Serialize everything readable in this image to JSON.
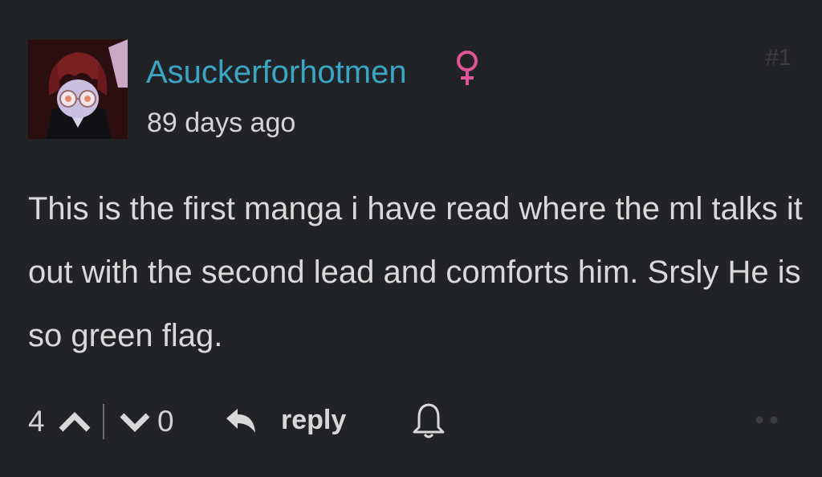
{
  "comment": {
    "username": "Asuckerforhotmen",
    "gender_icon": "female-symbol-icon",
    "timestamp": "89 days ago",
    "post_number": "#1",
    "body": "This is the first manga i have read where the ml talks it out with the second lead and comforts him. Srsly He is so green flag.",
    "upvotes": "4",
    "downvotes": "0",
    "reply_label": "reply",
    "icons": {
      "upvote": "chevron-up-icon",
      "downvote": "chevron-down-icon",
      "reply": "reply-arrow-icon",
      "subscribe": "bell-icon",
      "more": "more-dots-icon"
    }
  },
  "colors": {
    "background": "#222327",
    "username": "#3aa6c4",
    "female_symbol": "#e0559a",
    "text": "#d9d9d9",
    "post_number": "#3d3e43"
  }
}
